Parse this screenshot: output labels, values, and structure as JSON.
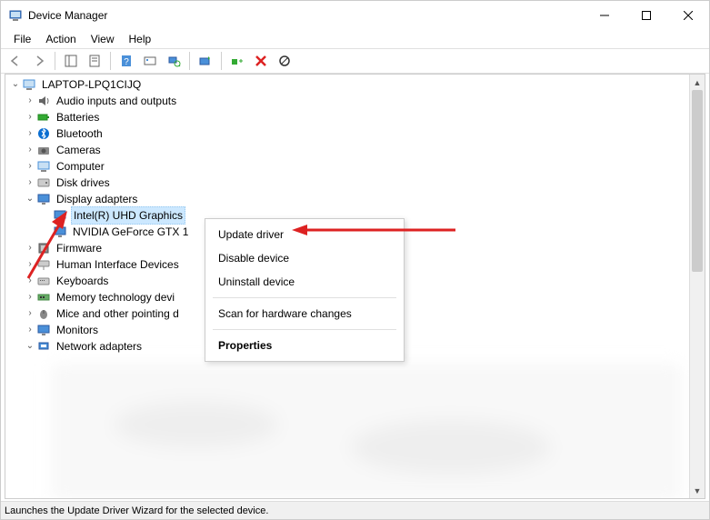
{
  "window": {
    "title": "Device Manager"
  },
  "menubar": {
    "file": "File",
    "action": "Action",
    "view": "View",
    "help": "Help"
  },
  "tree": {
    "root": "LAPTOP-LPQ1CIJQ",
    "items": {
      "audio": "Audio inputs and outputs",
      "batteries": "Batteries",
      "bluetooth": "Bluetooth",
      "cameras": "Cameras",
      "computer": "Computer",
      "disk": "Disk drives",
      "display": "Display adapters",
      "intel": "Intel(R) UHD Graphics",
      "nvidia": "NVIDIA GeForce GTX 1",
      "firmware": "Firmware",
      "hid": "Human Interface Devices",
      "keyboards": "Keyboards",
      "memory": "Memory technology devi",
      "mice": "Mice and other pointing d",
      "monitors": "Monitors",
      "network": "Network adapters"
    }
  },
  "context_menu": {
    "update": "Update driver",
    "disable": "Disable device",
    "uninstall": "Uninstall device",
    "scan": "Scan for hardware changes",
    "properties": "Properties"
  },
  "statusbar": {
    "text": "Launches the Update Driver Wizard for the selected device."
  }
}
